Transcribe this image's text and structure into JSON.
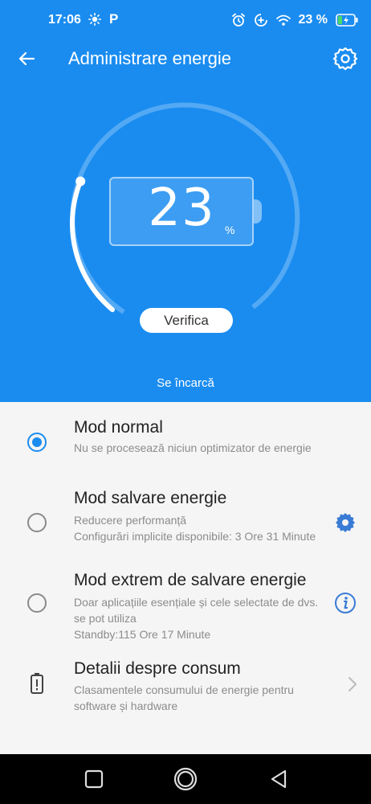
{
  "status_bar": {
    "time": "17:06",
    "p_glyph": "P",
    "battery_pct": "23 %",
    "icons": [
      "sun-icon",
      "alarm-icon",
      "data-saver-icon",
      "wifi-icon",
      "battery-charging-icon"
    ]
  },
  "header": {
    "title": "Administrare energie",
    "back_icon": "arrow-left-icon",
    "settings_icon": "gear-icon"
  },
  "battery": {
    "level": "23",
    "unit": "%",
    "level_fraction": 0.23
  },
  "verify_label": "Verifica",
  "charging_status": "Se încarcă",
  "modes": [
    {
      "title": "Mod normal",
      "subtitle_lines": [
        "Nu se procesează niciun optimizator de energie"
      ],
      "selected": true
    },
    {
      "title": "Mod salvare energie",
      "subtitle_lines": [
        "Reducere performanță",
        "Configurări implicite disponibile: 3 Ore 31 Minute"
      ],
      "selected": false,
      "action_icon": "gear-icon"
    },
    {
      "title": "Mod extrem de salvare energie",
      "subtitle_lines": [
        "Doar aplicațiile esențiale și cele selectate de dvs. se pot utiliza",
        "Standby:115 Ore 17 Minute"
      ],
      "selected": false,
      "action_icon": "info-icon"
    }
  ],
  "details": {
    "title": "Detalii despre consum",
    "subtitle": "Clasamentele consumului de energie pentru software și hardware",
    "icon": "battery-alert-icon",
    "chevron": "chevron-right-icon"
  },
  "colors": {
    "accent": "#1a8cf0",
    "background": "#f5f5f5",
    "navbar": "#000000"
  }
}
